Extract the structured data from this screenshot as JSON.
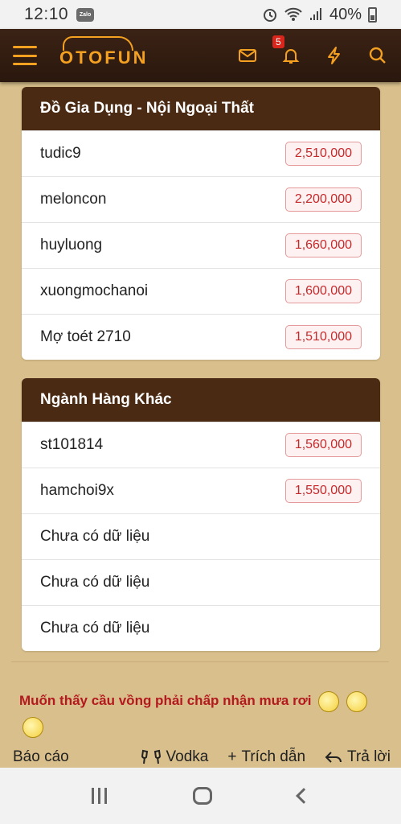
{
  "status_bar": {
    "time": "12:10",
    "app_badge": "Zalo",
    "battery": "40%"
  },
  "header": {
    "logo": "OTOFUN",
    "notification_count": "5"
  },
  "panels": [
    {
      "title": "Đồ Gia Dụng - Nội Ngoại Thất",
      "rows": [
        {
          "name": "tudic9",
          "value": "2,510,000"
        },
        {
          "name": "meloncon",
          "value": "2,200,000"
        },
        {
          "name": "huyluong",
          "value": "1,660,000"
        },
        {
          "name": "xuongmochanoi",
          "value": "1,600,000"
        },
        {
          "name": "Mợ toét 2710",
          "value": "1,510,000"
        }
      ]
    },
    {
      "title": "Ngành Hàng Khác",
      "rows": [
        {
          "name": "st101814",
          "value": "1,560,000"
        },
        {
          "name": "hamchoi9x",
          "value": "1,550,000"
        },
        {
          "name": "Chưa có dữ liệu",
          "value": ""
        },
        {
          "name": "Chưa có dữ liệu",
          "value": ""
        },
        {
          "name": "Chưa có dữ liệu",
          "value": ""
        }
      ]
    }
  ],
  "signature": "Muốn thấy cầu vồng phải chấp nhận mưa rơi",
  "actions": {
    "report": "Báo cáo",
    "reaction": "Vodka",
    "quote": "Trích dẫn",
    "reply": "Trả lời"
  },
  "colors": {
    "header_bg": "#2a170d",
    "accent": "#f4a020",
    "page_bg": "#d8bf8b",
    "value_red": "#c7292b"
  }
}
